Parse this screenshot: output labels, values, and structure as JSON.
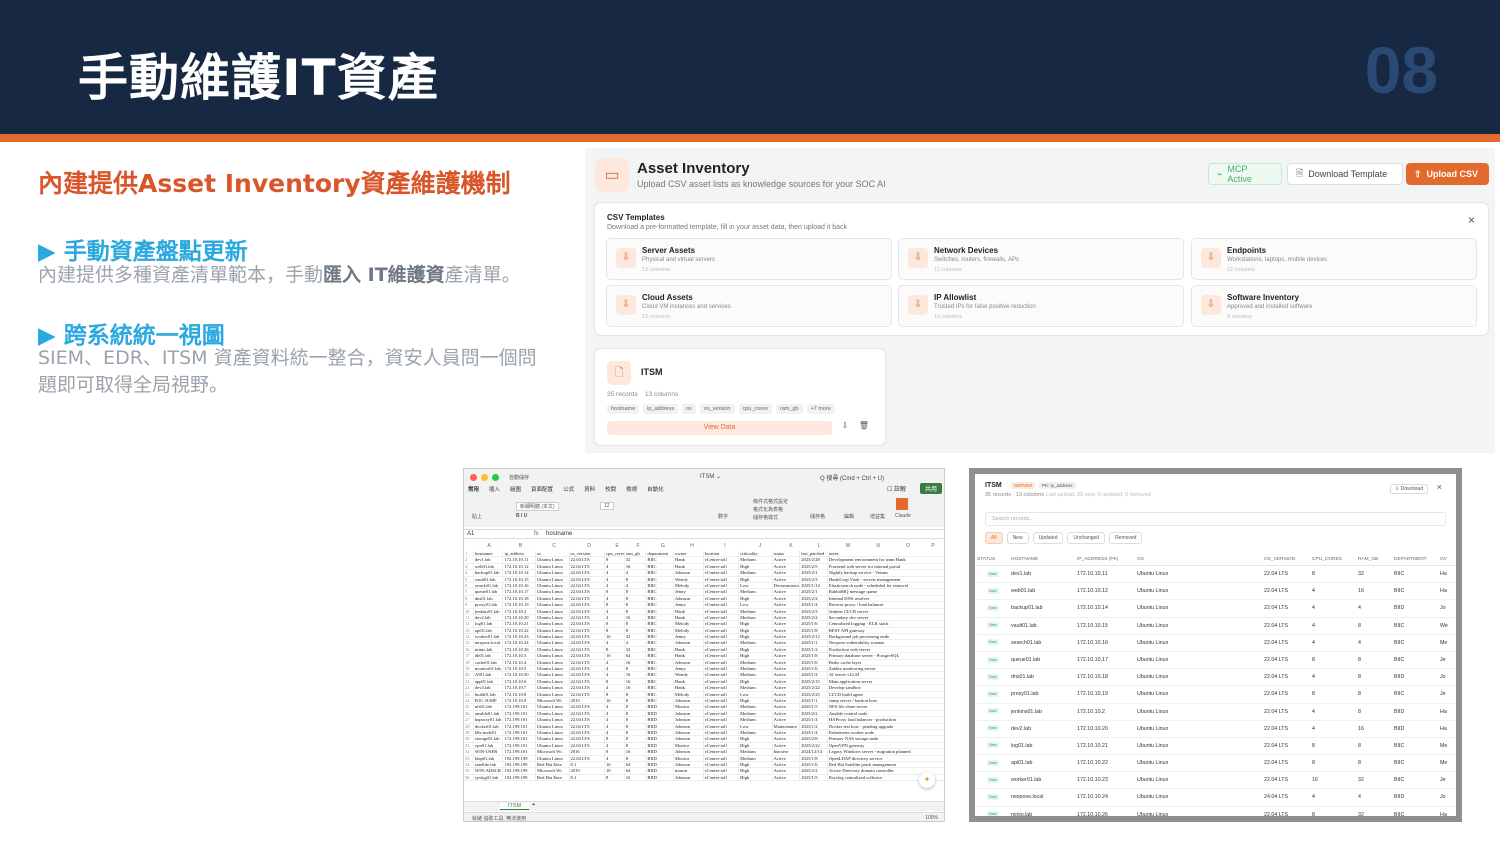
{
  "slide": {
    "title": "手動維護IT資產",
    "page_number": "08",
    "subtitle": "內建提供Asset Inventory資產維護機制",
    "bullets": [
      {
        "heading": "手動資產盤點更新",
        "text_a": "內建提供多種資產清單範本，手動",
        "text_b": "匯入 IT維護資",
        "text_c": "產清單。"
      },
      {
        "heading": "跨系統統一視圖",
        "text": "SIEM、EDR、ITSM 資產資料統一整合，資安人員問一個問題即可取得全局視野。"
      }
    ],
    "bullet_marker": "▶"
  },
  "asset_inventory": {
    "title": "Asset Inventory",
    "subtitle": "Upload CSV asset lists as knowledge sources for your SOC AI",
    "mcp_label": "MCP Active",
    "download_label": "Download Template",
    "upload_label": "Upload CSV",
    "csv_title": "CSV Templates",
    "csv_subtitle": "Download a pre-formatted template, fill in your asset data, then upload it back",
    "close": "×",
    "templates": [
      {
        "name": "Server Assets",
        "desc": "Physical and virtual servers",
        "cols": "13 columns"
      },
      {
        "name": "Network Devices",
        "desc": "Switches, routers, firewalls, APs",
        "cols": "11 columns"
      },
      {
        "name": "Endpoints",
        "desc": "Workstations, laptops, mobile devices",
        "cols": "12 columns"
      },
      {
        "name": "Cloud Assets",
        "desc": "Cloud VM instances and services",
        "cols": "12 columns"
      },
      {
        "name": "IP Allowlist",
        "desc": "Trusted IPs for false positive reduction",
        "cols": "10 columns"
      },
      {
        "name": "Software Inventory",
        "desc": "Approved and installed software",
        "cols": "9 columns"
      }
    ],
    "itsm_card": {
      "name": "ITSM",
      "records": "35 records",
      "columns": "13 columns",
      "tags": [
        "hostname",
        "ip_address",
        "os",
        "os_version",
        "cpu_cores",
        "ram_gb",
        "+7 more"
      ],
      "view_label": "View Data"
    }
  },
  "spreadsheet": {
    "autosave": "自動儲存",
    "title": "ITSM ⌄",
    "search": "Q 搜尋 (Cmd + Ctrl + U)",
    "menu": [
      "常用",
      "插入",
      "繪圖",
      "頁面配置",
      "公式",
      "資料",
      "校閱",
      "檢視",
      "自動化"
    ],
    "comment": "☐ 註解",
    "share": "共用",
    "ribbon": [
      "貼上",
      "新細明體 (本文)",
      "12",
      "數字",
      "條件式格式設定",
      "格式化為表格",
      "儲存格樣式",
      "儲存格",
      "編輯",
      "增益集",
      "Claude"
    ],
    "cell_ref": "A1",
    "formula": "hostname",
    "col_letters": [
      "A",
      "B",
      "C",
      "D",
      "E",
      "F",
      "G",
      "H",
      "I",
      "J",
      "K",
      "L",
      "M",
      "N",
      "O",
      "P"
    ],
    "header": [
      "hostname",
      "ip_address",
      "os",
      "os_version",
      "cpu_cores",
      "ram_gb",
      "department",
      "owner",
      "location",
      "criticality",
      "status",
      "last_patched",
      "notes"
    ],
    "rows": [
      [
        "dev1.lab",
        "172.10.10.11",
        "Ubuntu Linux",
        "22.04 LTS",
        "8",
        "32",
        "BIIC",
        "Hank",
        "vCenter-toll",
        "Medium",
        "Active",
        "2025/2/28",
        "Development environment for team Hank"
      ],
      [
        "web01.lab",
        "172.10.10.12",
        "Ubuntu Linux",
        "22.04 LTS",
        "4",
        "16",
        "BIIC",
        "Hank",
        "vCenter-toll",
        "High",
        "Active",
        "2025/2/5",
        "Frontend web server for internal portal"
      ],
      [
        "backup01.lab",
        "172.10.10.14",
        "Ubuntu Linux",
        "22.04 LTS",
        "4",
        "4",
        "BIIC",
        "Johnson",
        "vCenter-toll",
        "Medium",
        "Active",
        "2025/2/1",
        "Nightly backup service - Veeam"
      ],
      [
        "vault01.lab",
        "172.10.10.15",
        "Ubuntu Linux",
        "22.04 LTS",
        "4",
        "8",
        "BIIC",
        "Wendy",
        "vCenter-toll",
        "High",
        "Active",
        "2025/2/3",
        "HashiCorp Vault - secrets management"
      ],
      [
        "search01.lab",
        "172.10.10.16",
        "Ubuntu Linux",
        "22.04 LTS",
        "4",
        "4",
        "BIIC",
        "Melody",
        "vCenter-toll",
        "Low",
        "Decommissio",
        "2025/1/14",
        "Elasticsearch node - scheduled for removal"
      ],
      [
        "queue01.lab",
        "172.10.10.17",
        "Ubuntu Linux",
        "22.04 LTS",
        "8",
        "8",
        "BIIC",
        "Jenny",
        "vCenter-toll",
        "Medium",
        "Active",
        "2025/2/1",
        "RabbitMQ message queue"
      ],
      [
        "dns01.lab",
        "172.10.10.18",
        "Ubuntu Linux",
        "22.04 LTS",
        "4",
        "8",
        "BIIC",
        "Johnson",
        "vCenter-toll",
        "High",
        "Active",
        "2025/2/2",
        "Internal DNS resolver"
      ],
      [
        "proxy01.lab",
        "172.10.10.19",
        "Ubuntu Linux",
        "22.04 LTS",
        "8",
        "8",
        "BIIC",
        "Jenny",
        "vCenter-toll",
        "Low",
        "Active",
        "2025/1/4",
        "Reverse proxy / load balancer"
      ],
      [
        "jenkins01.lab",
        "172.10.10.2",
        "Ubuntu Linux",
        "22.04 LTS",
        "4",
        "8",
        "BIIC",
        "Hank",
        "vCenter-toll",
        "Medium",
        "Active",
        "2025/2/3",
        "Jenkins CI/CD server"
      ],
      [
        "dev2.lab",
        "172.10.10.20",
        "Ubuntu Linux",
        "22.04 LTS",
        "4",
        "16",
        "BIIC",
        "Hank",
        "vCenter-toll",
        "Medium",
        "Active",
        "2025/2/2",
        "Secondary dev server"
      ],
      [
        "log01.lab",
        "172.10.10.21",
        "Ubuntu Linux",
        "22.04 LTS",
        "8",
        "8",
        "BIIC",
        "Melody",
        "vCenter-toll",
        "High",
        "Active",
        "2025/1/6",
        "Centralized logging - ELK stack"
      ],
      [
        "api01.lab",
        "172.10.10.22",
        "Ubuntu Linux",
        "22.04 LTS",
        "8",
        "8",
        "BIIC",
        "Melody",
        "vCenter-toll",
        "High",
        "Active",
        "2025/1/8",
        "REST API gateway"
      ],
      [
        "worker01.lab",
        "172.10.10.23",
        "Ubuntu Linux",
        "22.04 LTS",
        "16",
        "32",
        "BIIC",
        "Jenny",
        "vCenter-toll",
        "High",
        "Active",
        "2025/2/12",
        "Background job processing node"
      ],
      [
        "nexpose.local",
        "172.10.10.24",
        "Ubuntu Linux",
        "24.04 LTS",
        "4",
        "4",
        "BIIC",
        "Johnson",
        "vCenter-toll",
        "Medium",
        "Active",
        "2025/1/1",
        "Nexpose vulnerability scanner"
      ],
      [
        "minio.lab",
        "172.10.10.26",
        "Ubuntu Linux",
        "22.04 LTS",
        "8",
        "32",
        "BIIC",
        "Hank",
        "vCenter-toll",
        "High",
        "Active",
        "2025/1/2",
        "Production web server"
      ],
      [
        "db01.lab",
        "172.10.10.3",
        "Ubuntu Linux",
        "22.04 LTS",
        "16",
        "64",
        "BIIC",
        "Hank",
        "vCenter-toll",
        "High",
        "Active",
        "2025/1/8",
        "Primary database server - PostgreSQL"
      ],
      [
        "cache01.lab",
        "172.10.10.4",
        "Ubuntu Linux",
        "22.04 LTS",
        "4",
        "16",
        "BIIC",
        "Johnson",
        "vCenter-toll",
        "Medium",
        "Active",
        "2025/1/6",
        "Redis cache layer"
      ],
      [
        "monitor01.lab",
        "172.10.10.5",
        "Ubuntu Linux",
        "22.04 LTS",
        "4",
        "8",
        "BIIC",
        "Jenny",
        "vCenter-toll",
        "Medium",
        "Active",
        "2025/1/6",
        "Zabbix monitoring server"
      ],
      [
        "AI01.lab",
        "172.10.10.50",
        "Ubuntu Linux",
        "22.04 LTS",
        "4",
        "16",
        "BIIC",
        "Wendy",
        "vCenter-toll",
        "Medium",
        "Active",
        "2025/1/4",
        "AI server vLLM"
      ],
      [
        "app01.lab",
        "172.10.10.6",
        "Ubuntu Linux",
        "22.04 LTS",
        "8",
        "16",
        "BIIC",
        "Hank",
        "vCenter-toll",
        "High",
        "Active",
        "2025/2/15",
        "Main application server"
      ],
      [
        "dev3.lab",
        "172.10.10.7",
        "Ubuntu Linux",
        "22.04 LTS",
        "4",
        "16",
        "BIIC",
        "Hank",
        "vCenter-toll",
        "Medium",
        "Active",
        "2025/2/22",
        "Develop sandbox"
      ],
      [
        "build01.lab",
        "172.10.10.8",
        "Ubuntu Linux",
        "22.04 LTS",
        "8",
        "8",
        "BIIC",
        "Melody",
        "vCenter-toll",
        "Low",
        "Active",
        "2025/2/25",
        "CI/CD build agent"
      ],
      [
        "B1C-JUMP",
        "172.10.10.9",
        "Microsoft Wi",
        "2019",
        "16",
        "8",
        "BIIC",
        "Johnson",
        "vCenter-toll",
        "High",
        "Active",
        "2025/1/1",
        "Jump server / bastion host"
      ],
      [
        "nfs01.lab",
        "172.199.101",
        "Ubuntu Linux",
        "22.04 LTS",
        "4",
        "8",
        "BIID",
        "Monica",
        "vCenter-toll",
        "Medium",
        "Active",
        "2025/1/5",
        "NFS file share server"
      ],
      [
        "ansible01.lab",
        "172.199.101",
        "Ubuntu Linux",
        "22.04 LTS",
        "4",
        "8",
        "BIID",
        "Johnson",
        "vCenter-toll",
        "Medium",
        "Active",
        "2025/2/2",
        "Ansible control node"
      ],
      [
        "haproxy01.lab",
        "172.199.101",
        "Ubuntu Linux",
        "22.04 LTS",
        "4",
        "8",
        "BIID",
        "Johnson",
        "vCenter-toll",
        "Medium",
        "Active",
        "2025/1/4",
        "HAProxy load balancer - production"
      ],
      [
        "docker01.lab",
        "172.199.101",
        "Ubuntu Linux",
        "22.04 LTS",
        "4",
        "8",
        "BIID",
        "Johnson",
        "vCenter-toll",
        "Low",
        "Maintenance",
        "2025/1/2",
        "Docker test host - pending upgrade"
      ],
      [
        "k8s-node01",
        "172.199.101",
        "Ubuntu Linux",
        "22.04 LTS",
        "4",
        "8",
        "BIID",
        "Johnson",
        "vCenter-toll",
        "Medium",
        "Active",
        "2025/1/4",
        "Kubernetes worker node"
      ],
      [
        "storage01.lab",
        "172.199.101",
        "Ubuntu Linux",
        "22.04 LTS",
        "8",
        "8",
        "BIID",
        "Johnson",
        "vCenter-toll",
        "High",
        "Active",
        "2025/2/8",
        "Primary NAS storage node"
      ],
      [
        "vpn01.lab",
        "172.199.101",
        "Ubuntu Linux",
        "22.04 LTS",
        "4",
        "8",
        "BIID",
        "Monica",
        "vCenter-toll",
        "High",
        "Active",
        "2025/2/22",
        "OpenVPN gateway"
      ],
      [
        "WIN-USER",
        "172.199.101",
        "Microsoft Wi",
        "2016",
        "8",
        "16",
        "BIID",
        "Johnson",
        "vCenter-toll",
        "Medium",
        "Inactive",
        "2024/12/14",
        "Legacy Windows server - migration planned"
      ],
      [
        "ldap01.lab",
        "192.199.199",
        "Ubuntu Linux",
        "22.04 LTS",
        "4",
        "8",
        "BIID",
        "Monica",
        "vCenter-toll",
        "Medium",
        "Active",
        "2025/1/8",
        "OpenLDAP directory service"
      ],
      [
        "satellite.lab",
        "192.199.199",
        "Red Hat Ente",
        "8.1",
        "16",
        "64",
        "BIID",
        "Johnson",
        "vCenter-toll",
        "High",
        "Active",
        "2025/1/6",
        "Red Hat Satellite patch management"
      ],
      [
        "WIN-ADSCR",
        "192.199.199",
        "Microsoft Wi",
        "2019",
        "16",
        "64",
        "BIID",
        "mason",
        "vCenter-toll",
        "High",
        "Active",
        "2025/2/2",
        "Active Directory domain controller"
      ],
      [
        "syslog01.lab",
        "192.199.199",
        "Red Hat Ente",
        "8.1",
        "8",
        "16",
        "BIID",
        "Johnson",
        "vCenter-toll",
        "High",
        "Active",
        "2025/1/5",
        "Rsyslog centralized collector"
      ]
    ],
    "sheet_tab": "ITSM",
    "status": "就緒   協助工具: 無法使用",
    "zoom": "100%"
  },
  "itsm_table": {
    "title": "ITSM",
    "badge1": "SERVER",
    "badge2": "PK: ip_address",
    "meta": "35 records · 13 columns",
    "meta_note": "Last upload: 35 new, 0 updated, 0 removed",
    "download": "Download",
    "close": "×",
    "search_placeholder": "Search records...",
    "filters": [
      "All",
      "New",
      "Updated",
      "Unchanged",
      "Removed"
    ],
    "headers": [
      "STATUS",
      "HOSTNAME",
      "IP_ADDRESS (PK)",
      "OS",
      "OS_VERSION",
      "CPU_CORES",
      "RAM_GB",
      "DEPARTMENT",
      "OV"
    ],
    "new_badge": "New",
    "rows": [
      [
        "dev1.lab",
        "172.10.10.11",
        "Ubuntu Linux",
        "22.04 LTS",
        "8",
        "32",
        "BIIC",
        "Ha"
      ],
      [
        "web01.lab",
        "172.10.10.12",
        "Ubuntu Linux",
        "22.04 LTS",
        "4",
        "16",
        "BIIC",
        "Ha"
      ],
      [
        "backup01.lab",
        "172.10.10.14",
        "Ubuntu Linux",
        "22.04 LTS",
        "4",
        "4",
        "BIID",
        "Jo"
      ],
      [
        "vault01.lab",
        "172.10.10.15",
        "Ubuntu Linux",
        "22.04 LTS",
        "4",
        "8",
        "BIIC",
        "We"
      ],
      [
        "search01.lab",
        "172.10.10.16",
        "Ubuntu Linux",
        "22.04 LTS",
        "4",
        "4",
        "BIIC",
        "Me"
      ],
      [
        "queue01.lab",
        "172.10.10.17",
        "Ubuntu Linux",
        "22.04 LTS",
        "8",
        "8",
        "BIIC",
        "Je"
      ],
      [
        "dns01.lab",
        "172.10.10.18",
        "Ubuntu Linux",
        "22.04 LTS",
        "4",
        "8",
        "BIID",
        "Jo"
      ],
      [
        "proxy01.lab",
        "172.10.10.19",
        "Ubuntu Linux",
        "22.04 LTS",
        "8",
        "8",
        "BIIC",
        "Je"
      ],
      [
        "jenkins01.lab",
        "172.10.10.2",
        "Ubuntu Linux",
        "22.04 LTS",
        "4",
        "8",
        "BIID",
        "Ha"
      ],
      [
        "dev2.lab",
        "172.10.10.20",
        "Ubuntu Linux",
        "22.04 LTS",
        "4",
        "16",
        "BIID",
        "Ha"
      ],
      [
        "log01.lab",
        "172.10.10.21",
        "Ubuntu Linux",
        "22.04 LTS",
        "8",
        "8",
        "BIIC",
        "Me"
      ],
      [
        "api01.lab",
        "172.10.10.22",
        "Ubuntu Linux",
        "22.04 LTS",
        "8",
        "8",
        "BIIC",
        "Me"
      ],
      [
        "worker01.lab",
        "172.10.10.23",
        "Ubuntu Linux",
        "22.04 LTS",
        "16",
        "32",
        "BIIC",
        "Je"
      ],
      [
        "nexpose.local",
        "172.10.10.24",
        "Ubuntu Linux",
        "24.04 LTS",
        "4",
        "4",
        "BIID",
        "Jo"
      ],
      [
        "minio.lab",
        "172.10.10.26",
        "Ubuntu Linux",
        "22.04 LTS",
        "8",
        "32",
        "BIIC",
        "Ha"
      ]
    ]
  }
}
